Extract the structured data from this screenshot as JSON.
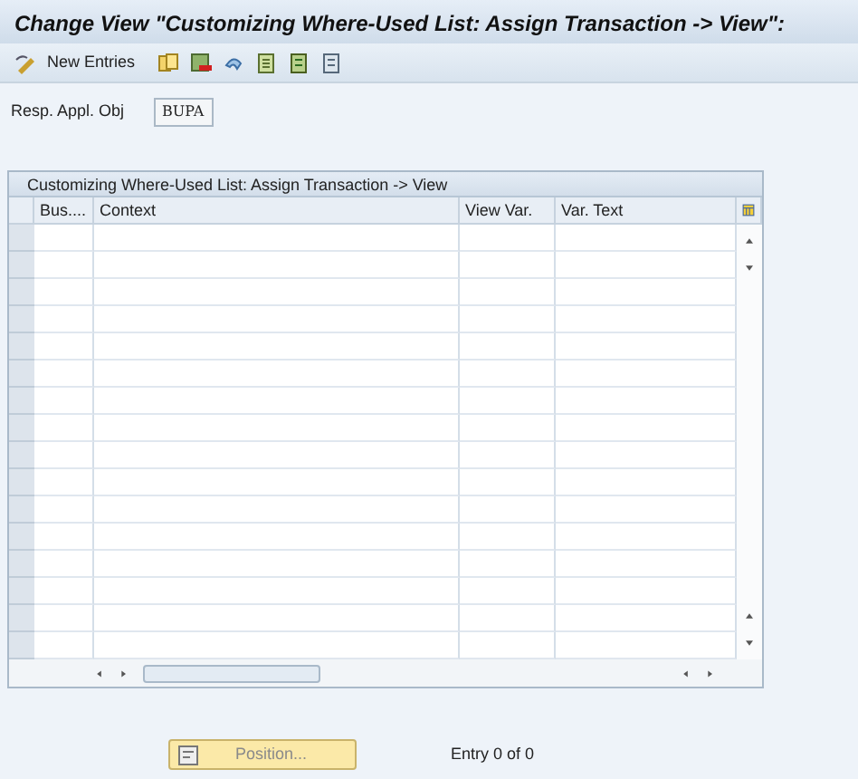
{
  "window": {
    "title": "Change View \"Customizing Where-Used List: Assign Transaction -> View\":"
  },
  "toolbar": {
    "new_entries": "New Entries"
  },
  "field": {
    "label": "Resp. Appl. Obj",
    "value": "BUPA"
  },
  "table": {
    "title": "Customizing Where-Used List: Assign Transaction -> View",
    "columns": [
      "Bus....",
      "Context",
      "View Var.",
      "Var. Text"
    ]
  },
  "position_button": {
    "label": "Position...",
    "disabled": true
  },
  "entry_info": "Entry 0 of 0"
}
